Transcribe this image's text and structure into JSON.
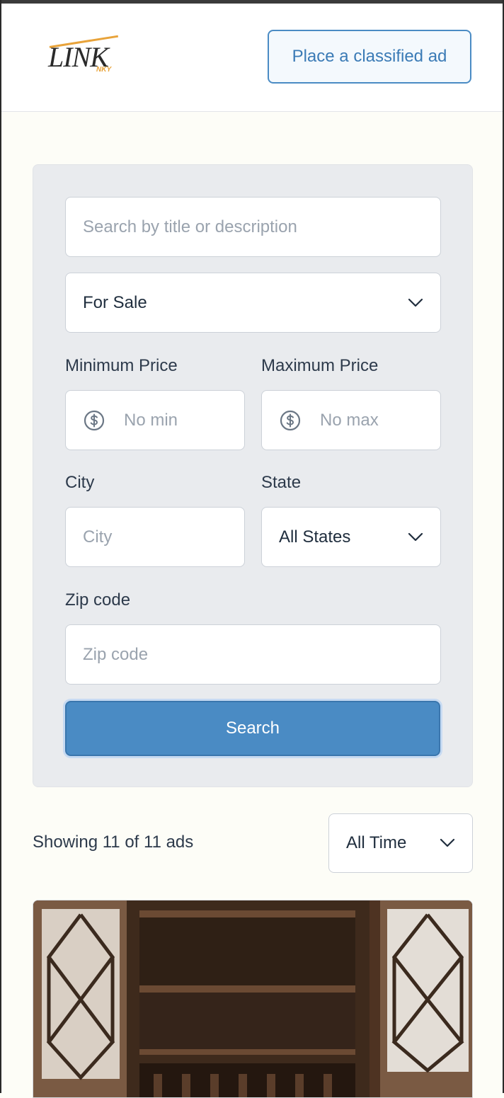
{
  "header": {
    "logo_text": "LINK",
    "logo_sub": "NKY",
    "place_ad_label": "Place a classified ad"
  },
  "filters": {
    "search_placeholder": "Search by title or description",
    "category_value": "For Sale",
    "min_price_label": "Minimum Price",
    "min_price_placeholder": "No min",
    "max_price_label": "Maximum Price",
    "max_price_placeholder": "No max",
    "city_label": "City",
    "city_placeholder": "City",
    "state_label": "State",
    "state_value": "All States",
    "zip_label": "Zip code",
    "zip_placeholder": "Zip code",
    "search_button_label": "Search"
  },
  "results": {
    "showing_text": "Showing 11 of 11 ads",
    "time_filter_value": "All Time"
  },
  "colors": {
    "accent": "#4a8bc4",
    "panel_bg": "#e9ebee",
    "page_bg": "#fdfdf7",
    "logo_orange": "#e8a33a"
  },
  "icons": [
    "dollar-icon",
    "chevron-down-icon"
  ]
}
